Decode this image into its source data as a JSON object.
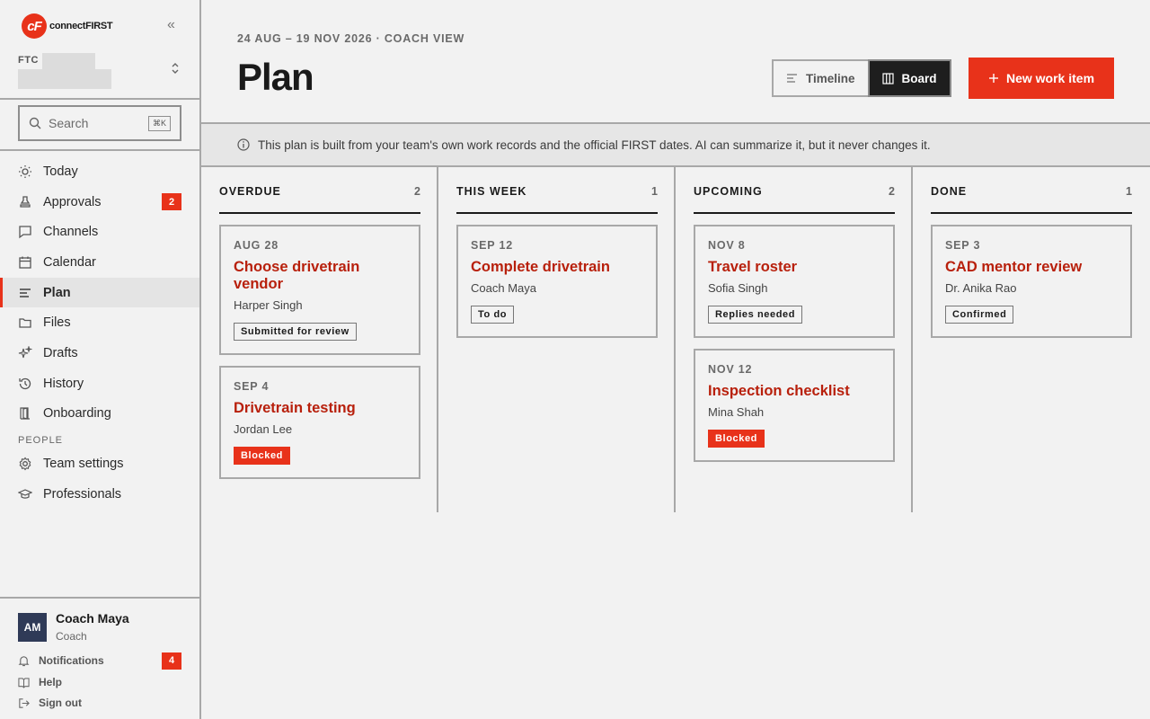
{
  "app": {
    "brand_mark": "cF",
    "brand_name": "connectFIRST",
    "team_code": "FTC"
  },
  "search": {
    "placeholder": "Search",
    "shortcut": "⌘K"
  },
  "nav": {
    "items": [
      {
        "label": "Today",
        "icon": "sun-icon"
      },
      {
        "label": "Approvals",
        "icon": "stamp-icon",
        "badge": "2"
      },
      {
        "label": "Channels",
        "icon": "chat-icon"
      },
      {
        "label": "Calendar",
        "icon": "calendar-icon"
      },
      {
        "label": "Plan",
        "icon": "list-icon",
        "active": true
      },
      {
        "label": "Files",
        "icon": "folder-icon"
      },
      {
        "label": "Drafts",
        "icon": "sparkle-icon"
      },
      {
        "label": "History",
        "icon": "history-icon"
      },
      {
        "label": "Onboarding",
        "icon": "door-icon"
      }
    ],
    "section_people": "PEOPLE",
    "people_items": [
      {
        "label": "Team settings",
        "icon": "gear-icon"
      },
      {
        "label": "Professionals",
        "icon": "graduation-cap-icon"
      }
    ]
  },
  "user": {
    "initials": "AM",
    "name": "Coach Maya",
    "role": "Coach"
  },
  "footer": {
    "notifications": "Notifications",
    "notifications_badge": "4",
    "help": "Help",
    "sign_out": "Sign out"
  },
  "header": {
    "breadcrumb": "24 AUG – 19 NOV 2026 · COACH VIEW",
    "title": "Plan",
    "view_timeline": "Timeline",
    "view_board": "Board",
    "new_item": "New work item"
  },
  "info_text": "This plan is built from your team's own work records and the official FIRST dates. AI can summarize it, but it never changes it.",
  "columns": [
    {
      "title": "OVERDUE",
      "count": "2",
      "cards": [
        {
          "date": "AUG 28",
          "title": "Choose drivetrain vendor",
          "person": "Harper Singh",
          "status": "Submitted for review",
          "blocked": false
        },
        {
          "date": "SEP 4",
          "title": "Drivetrain testing",
          "person": "Jordan Lee",
          "status": "Blocked",
          "blocked": true
        }
      ]
    },
    {
      "title": "THIS WEEK",
      "count": "1",
      "cards": [
        {
          "date": "SEP 12",
          "title": "Complete drivetrain",
          "person": "Coach Maya",
          "status": "To do",
          "blocked": false
        }
      ]
    },
    {
      "title": "UPCOMING",
      "count": "2",
      "cards": [
        {
          "date": "NOV 8",
          "title": "Travel roster",
          "person": "Sofia Singh",
          "status": "Replies needed",
          "blocked": false
        },
        {
          "date": "NOV 12",
          "title": "Inspection checklist",
          "person": "Mina Shah",
          "status": "Blocked",
          "blocked": true
        }
      ]
    },
    {
      "title": "DONE",
      "count": "1",
      "cards": [
        {
          "date": "SEP 3",
          "title": "CAD mentor review",
          "person": "Dr. Anika Rao",
          "status": "Confirmed",
          "blocked": false
        }
      ]
    }
  ],
  "colors": {
    "accent": "#e8321a",
    "title_red": "#b8200c",
    "dark": "#1e1e1e",
    "avatar": "#2f3a57"
  }
}
